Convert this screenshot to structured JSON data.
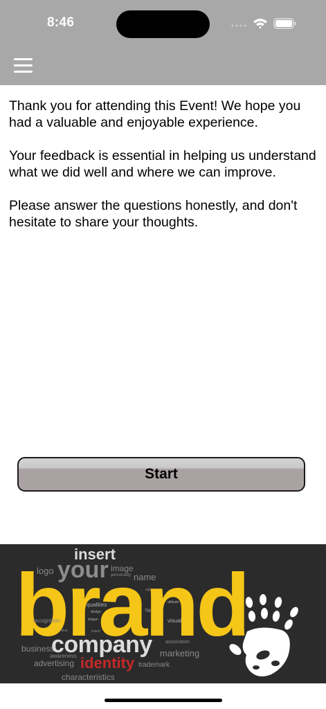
{
  "status_bar": {
    "time": "8:46"
  },
  "header": {
    "menu_icon": "hamburger-menu-icon"
  },
  "intro": {
    "paragraph_1": "Thank you for attending this Event! We hope you had a valuable and enjoyable experience.",
    "paragraph_2": "Your feedback is essential in helping us understand what we did well and where we can improve.",
    "paragraph_3": "Please answer the questions honestly, and don't hesitate to share your thoughts."
  },
  "start_button": {
    "label": "Start"
  },
  "banner": {
    "insert": "insert",
    "logo": "logo",
    "your": "your",
    "image": "image",
    "personality": "personality",
    "name": "name",
    "sign": "sign",
    "brand": "brand",
    "qualities": "qualities",
    "design": "design",
    "slogan": "slogan",
    "tm": "TM",
    "attitude": "attitude",
    "visual": "visual",
    "recognition": "recognition",
    "value": "value",
    "brand_small": "brand",
    "business": "business",
    "company": "company",
    "association": "association",
    "awareness": "awareness",
    "marketing": "marketing",
    "advertising": "advertising",
    "identity": "identity",
    "trademark": "trademark",
    "characteristics": "characteristics",
    "hand_icon": "handprint-icon"
  },
  "colors": {
    "header_bg": "#a8a8a8",
    "banner_bg": "#2b2b2b",
    "brand_yellow": "#f5c518",
    "identity_red": "#c62828"
  }
}
